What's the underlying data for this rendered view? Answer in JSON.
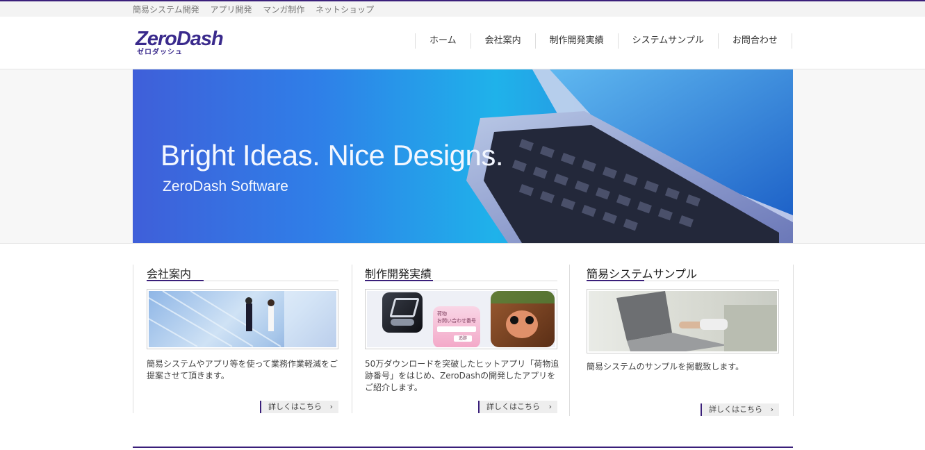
{
  "tagline": [
    "簡易システム開発",
    "アプリ開発",
    "マンガ制作",
    "ネットショップ"
  ],
  "logo": {
    "main": "ZeroDash",
    "sub": "ゼロダッシュ"
  },
  "nav": [
    "ホーム",
    "会社案内",
    "制作開発実績",
    "システムサンプル",
    "お問合わせ"
  ],
  "hero": {
    "headline": "Bright Ideas. Nice Designs.",
    "subheadline": "ZeroDash Software"
  },
  "sections": [
    {
      "title": "会社案内",
      "desc": "簡易システムやアプリ等を使って業務作業軽減をご提案させて頂きます。",
      "more": "詳しくはこちら"
    },
    {
      "title": "制作開発実績",
      "desc": "50万ダウンロードを突破したヒットアプリ「荷物追跡番号」をはじめ、ZeroDashの開発したアプリをご紹介します。",
      "more": "詳しくはこちら",
      "app_label_1": "荷物",
      "app_label_2": "お問い合わせ番号",
      "app_btn": "追跡"
    },
    {
      "title": "簡易システムサンプル",
      "desc": "簡易システムのサンプルを掲載致します。",
      "more": "詳しくはこちら"
    }
  ],
  "colors": {
    "accent": "#3a1f7a",
    "logo": "#3a2a8c"
  }
}
